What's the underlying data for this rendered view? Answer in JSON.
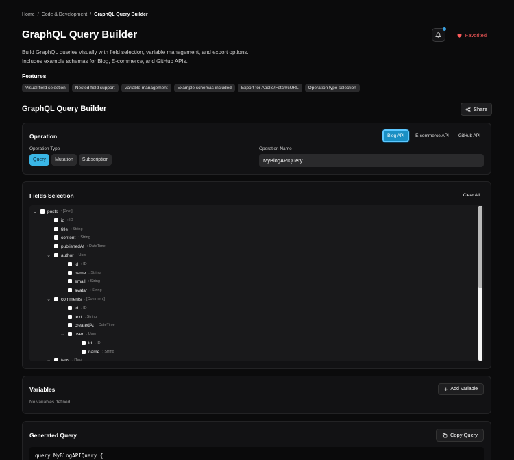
{
  "breadcrumb": {
    "items": [
      "Home",
      "Code & Development",
      "GraphQL Query Builder"
    ],
    "sep": "/"
  },
  "header": {
    "title": "GraphQL Query Builder",
    "favorite_label": "Favorited"
  },
  "description": {
    "line1": "Build GraphQL queries visually with field selection, variable management, and export options.",
    "line2": "Includes example schemas for Blog, E-commerce, and GitHub APIs."
  },
  "features": {
    "heading": "Features",
    "items": [
      "Visual field selection",
      "Nested field support",
      "Variable management",
      "Example schemas included",
      "Export for Apollo/Fetch/cURL",
      "Operation type selection"
    ]
  },
  "tool": {
    "title": "GraphQL Query Builder",
    "share_label": "Share"
  },
  "operation": {
    "heading": "Operation",
    "schemas": [
      "Blog API",
      "E-commerce API",
      "GitHub API"
    ],
    "type_label": "Operation Type",
    "types": [
      "Query",
      "Mutation",
      "Subscription"
    ],
    "name_label": "Operation Name",
    "name_value": "MyBlogAPIQuery"
  },
  "fields": {
    "heading": "Fields Selection",
    "clear_label": "Clear All",
    "rows": [
      {
        "name": "posts",
        "type": ": [Post]"
      },
      {
        "name": "id",
        "type": ": ID"
      },
      {
        "name": "title",
        "type": ": String"
      },
      {
        "name": "content",
        "type": ": String"
      },
      {
        "name": "publishedAt",
        "type": ": DateTime"
      },
      {
        "name": "author",
        "type": ": User"
      },
      {
        "name": "id",
        "type": ": ID"
      },
      {
        "name": "name",
        "type": ": String"
      },
      {
        "name": "email",
        "type": ": String"
      },
      {
        "name": "avatar",
        "type": ": String"
      },
      {
        "name": "comments",
        "type": ": [Comment]"
      },
      {
        "name": "id",
        "type": ": ID"
      },
      {
        "name": "text",
        "type": ": String"
      },
      {
        "name": "createdAt",
        "type": ": DateTime"
      },
      {
        "name": "user",
        "type": ": User"
      },
      {
        "name": "id",
        "type": ": ID"
      },
      {
        "name": "name",
        "type": ": String"
      },
      {
        "name": "tags",
        "type": ": [Tag]"
      }
    ]
  },
  "variables": {
    "heading": "Variables",
    "add_label": "Add Variable",
    "empty_text": "No variables defined"
  },
  "generated": {
    "heading": "Generated Query",
    "copy_label": "Copy Query",
    "code_line1": "query MyBlogAPIQuery {"
  }
}
